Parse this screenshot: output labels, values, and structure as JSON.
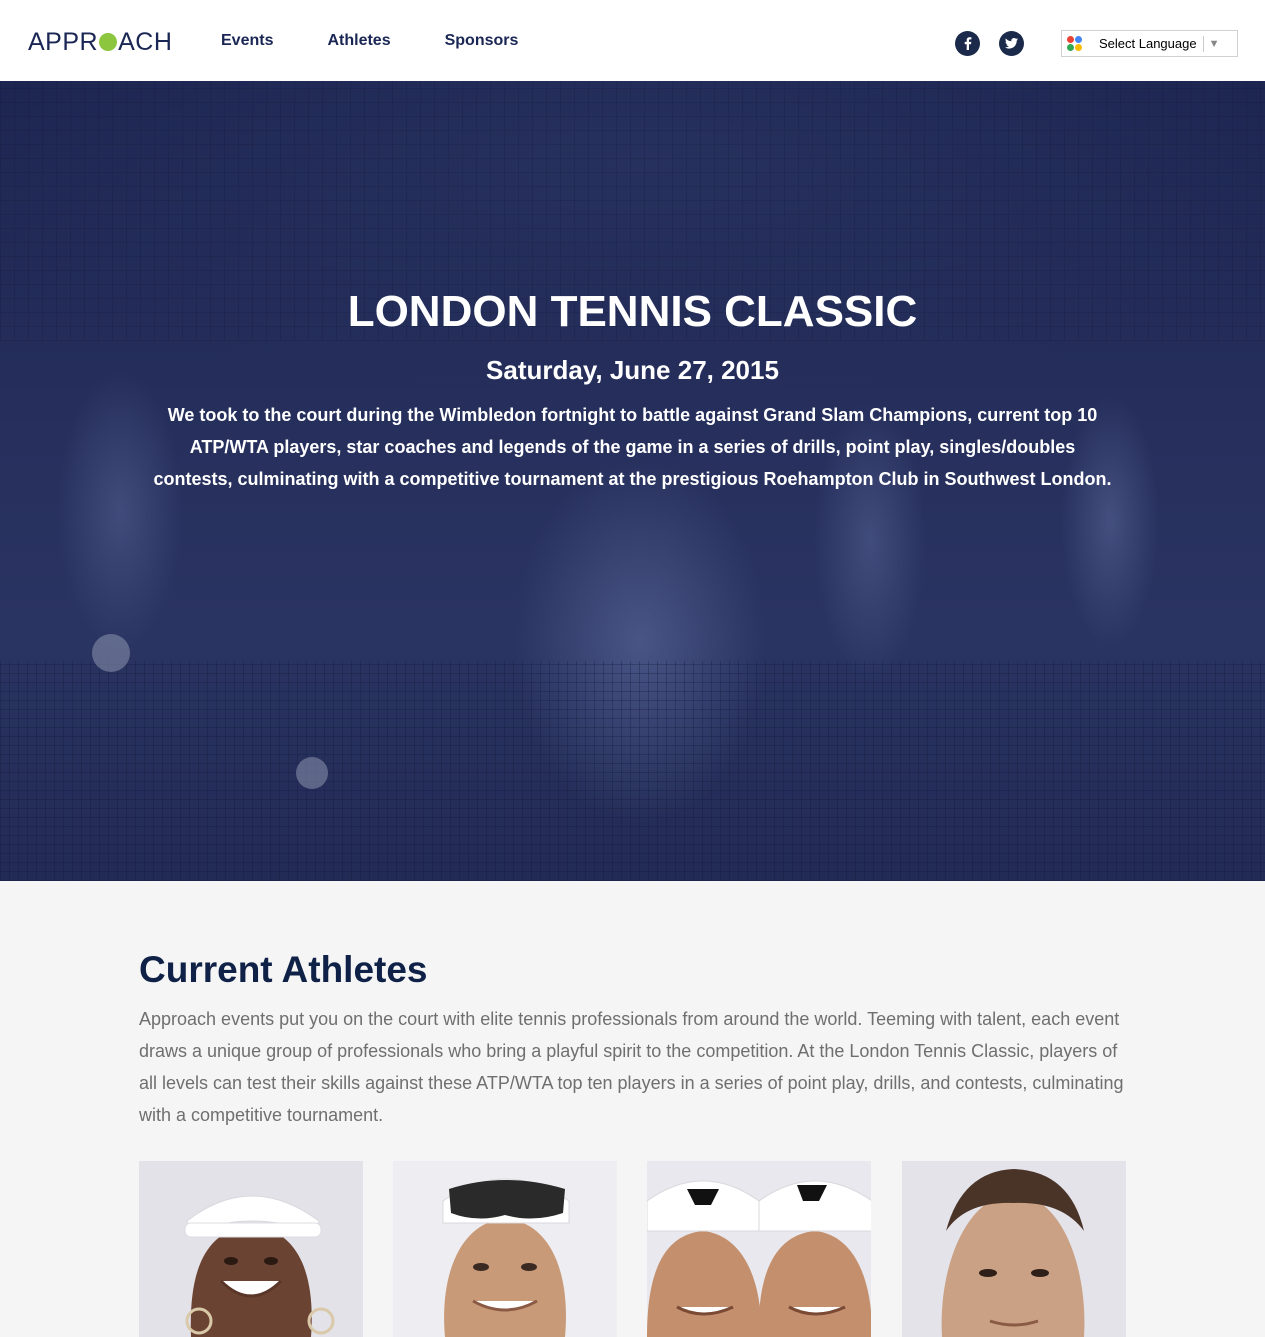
{
  "header": {
    "logo_text_left": "APPR",
    "logo_text_right": "ACH",
    "nav": [
      {
        "label": "Events"
      },
      {
        "label": "Athletes"
      },
      {
        "label": "Sponsors"
      }
    ],
    "language_select": {
      "label": "Select Language"
    }
  },
  "hero": {
    "title": "LONDON TENNIS CLASSIC",
    "date": "Saturday, June 27, 2015",
    "description": "We took to the court during the Wimbledon fortnight to battle against Grand Slam Champions, current top 10 ATP/WTA players, star coaches and legends of the game in a series of drills, point play, singles/doubles contests, culminating with a competitive tournament at the prestigious Roehampton Club in Southwest London."
  },
  "athletes": {
    "title": "Current Athletes",
    "description": "Approach events put you on the court with elite tennis professionals from around the world. Teeming with talent, each event draws a unique group of professionals who bring a playful spirit to the competition. At the London Tennis Classic, players of all levels can test their skills against these ATP/WTA top ten players in a series of point play, drills, and contests, culminating with a competitive tournament."
  },
  "colors": {
    "navy": "#1a2654",
    "accent_green": "#8cc63f",
    "text_gray": "#6f6f6f"
  }
}
